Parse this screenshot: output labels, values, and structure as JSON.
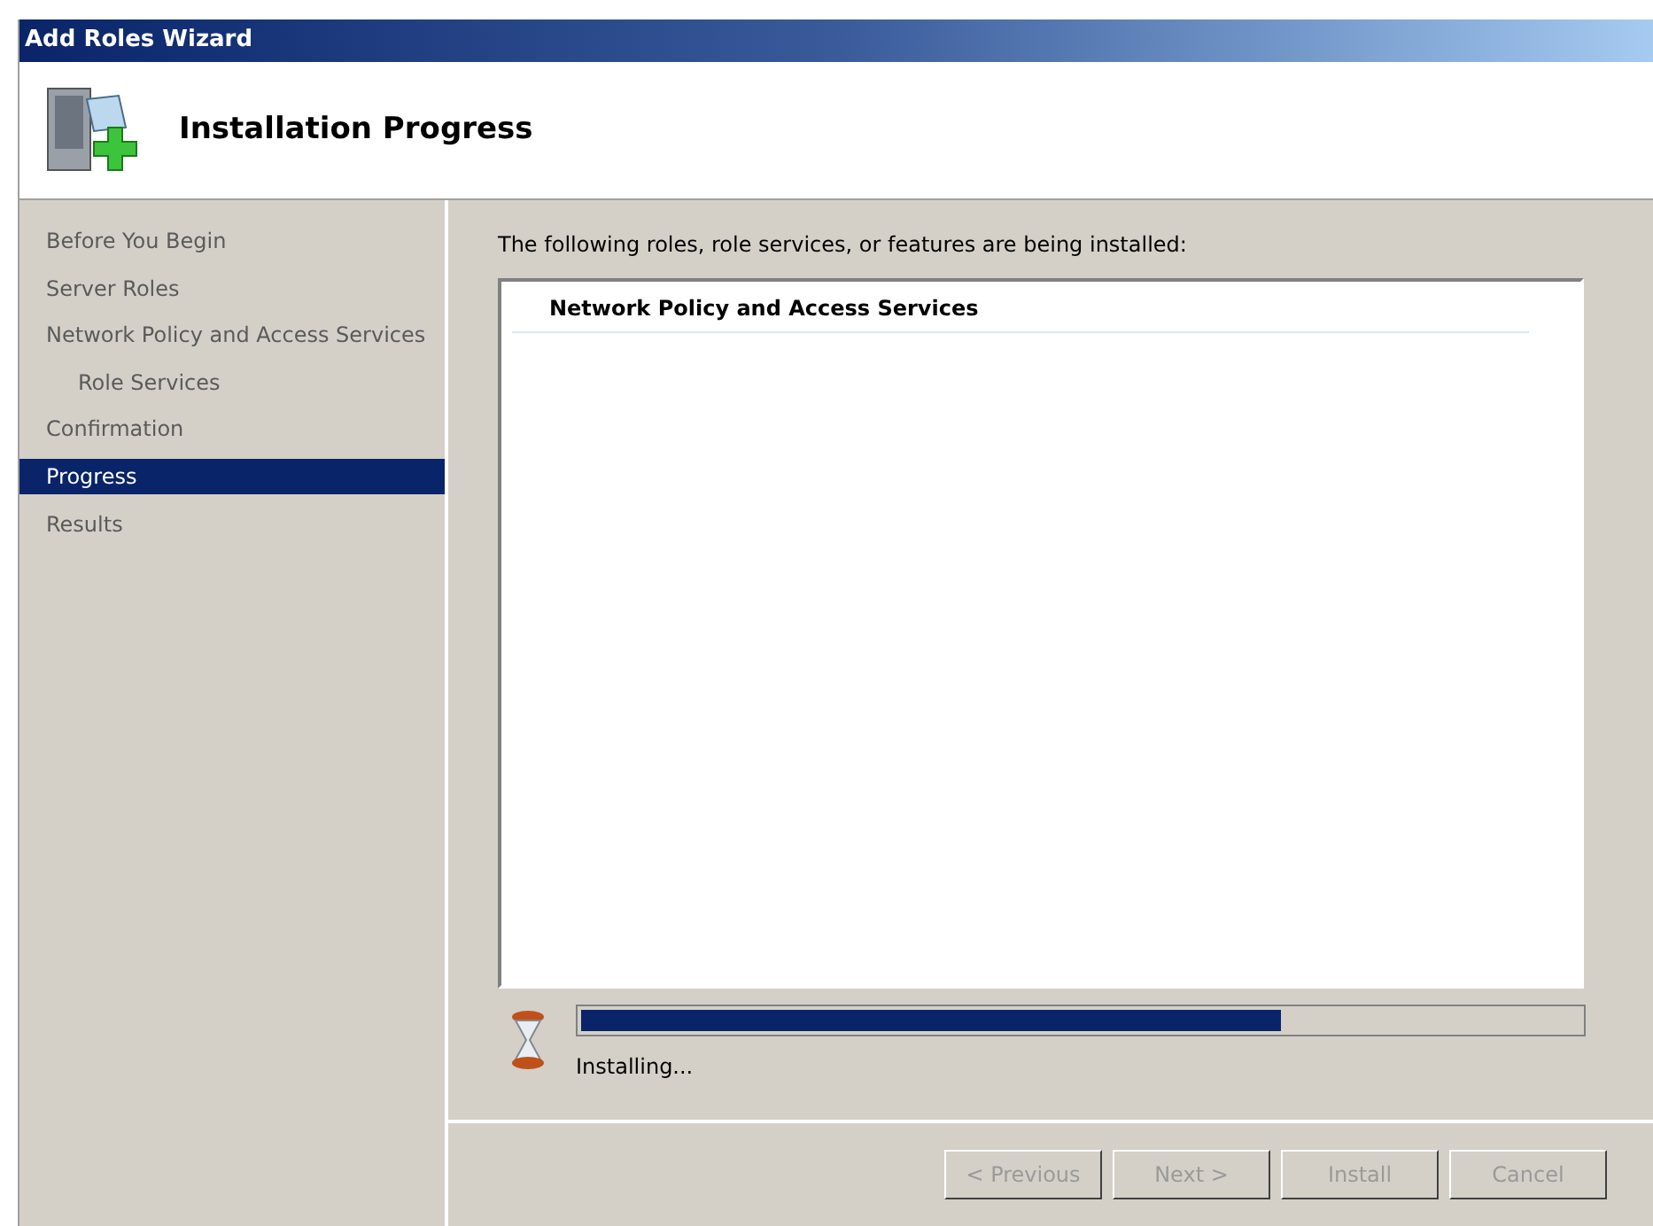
{
  "window": {
    "title": "Add Roles Wizard"
  },
  "header": {
    "title": "Installation Progress"
  },
  "sidebar": {
    "items": [
      {
        "label": "Before You Begin",
        "selected": false
      },
      {
        "label": "Server Roles",
        "selected": false
      },
      {
        "label": "Network Policy and Access Services",
        "selected": false,
        "children": [
          {
            "label": "Role Services",
            "selected": false
          }
        ]
      },
      {
        "label": "Confirmation",
        "selected": false
      },
      {
        "label": "Progress",
        "selected": true
      },
      {
        "label": "Results",
        "selected": false
      }
    ]
  },
  "content": {
    "intro": "The following roles, role services, or features are being installed:",
    "list": [
      "Network Policy and Access Services"
    ],
    "progress": {
      "level": 0.7,
      "status": "Installing..."
    }
  },
  "buttons": [
    {
      "label": "< Previous",
      "disabled": true
    },
    {
      "label": "Next >",
      "disabled": true
    },
    {
      "label": "Install",
      "disabled": true
    },
    {
      "label": "Cancel",
      "disabled": true
    }
  ]
}
